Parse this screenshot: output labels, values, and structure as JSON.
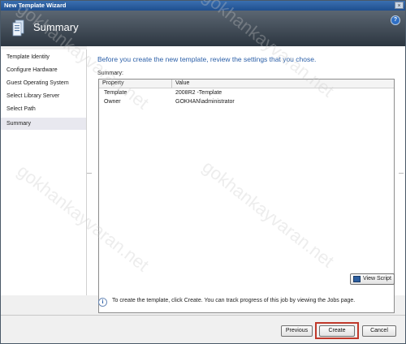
{
  "window": {
    "title": "New Template Wizard",
    "close_glyph": "×"
  },
  "header": {
    "heading": "Summary",
    "icon": "wizard-template-icon",
    "help_glyph": "?"
  },
  "sidebar": {
    "items": [
      {
        "label": "Template Identity",
        "active": false
      },
      {
        "label": "Configure Hardware",
        "active": false
      },
      {
        "label": "Guest Operating System",
        "active": false
      },
      {
        "label": "Select Library Server",
        "active": false
      },
      {
        "label": "Select Path",
        "active": false
      },
      {
        "label": "Summary",
        "active": true
      }
    ]
  },
  "main": {
    "intro": "Before you create the new template, review the settings that you chose.",
    "summary_label": "Summary:",
    "columns": [
      "Property",
      "Value"
    ],
    "rows": [
      {
        "property": "Template",
        "value": "2008R2 -Template"
      },
      {
        "property": "Owner",
        "value": "GOKHAN\\administrator"
      }
    ],
    "view_script": "View Script"
  },
  "info": {
    "glyph": "i",
    "text": "To create the template, click Create.  You can track progress of this job by viewing the Jobs page."
  },
  "buttons": {
    "previous": "Previous",
    "create": "Create",
    "cancel": "Cancel"
  },
  "watermark": "gokhankayvaran.net",
  "colors": {
    "accent": "#2b5fa8",
    "highlight": "#c0392b",
    "header_dark": "#2c3640"
  }
}
